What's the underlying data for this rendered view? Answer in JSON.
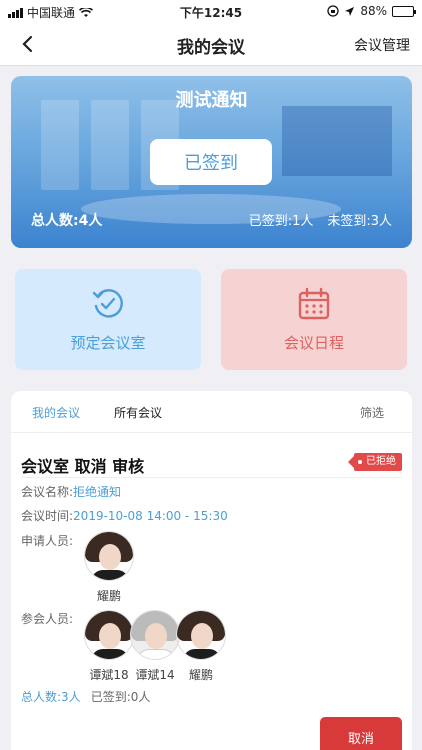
{
  "status_bar": {
    "carrier": "中国联通",
    "time": "下午12:45",
    "battery": "88%",
    "battery_level": 0.88
  },
  "nav": {
    "title": "我的会议",
    "manage": "会议管理"
  },
  "banner": {
    "title": "测试通知",
    "signed_button": "已签到",
    "total": "总人数:4人",
    "signed": "已签到:1人",
    "unsigned": "未签到:3人"
  },
  "cards": {
    "book_room": "预定会议室",
    "schedule": "会议日程"
  },
  "tabs": {
    "mine": "我的会议",
    "all": "所有会议",
    "filter": "筛选"
  },
  "meeting": {
    "title": "会议室 取消  审核",
    "badge": "已拒绝",
    "name_label": "会议名称:",
    "name_value": "拒绝通知",
    "time_label": "会议时间:",
    "time_value": "2019-10-08 14:00 - 15:30",
    "applicant_label": "申请人员:",
    "applicant_name": "耀鹏",
    "attendees_label": "参会人员:",
    "attendees": [
      "谭斌18",
      "谭斌14",
      "耀鹏"
    ],
    "total": "总人数:3人",
    "signed": "已签到:0人",
    "cancel_button": "取消"
  },
  "colors": {
    "accent_blue": "#4b9ed8",
    "accent_red": "#e24a4a",
    "cancel_red": "#d83a3a"
  }
}
